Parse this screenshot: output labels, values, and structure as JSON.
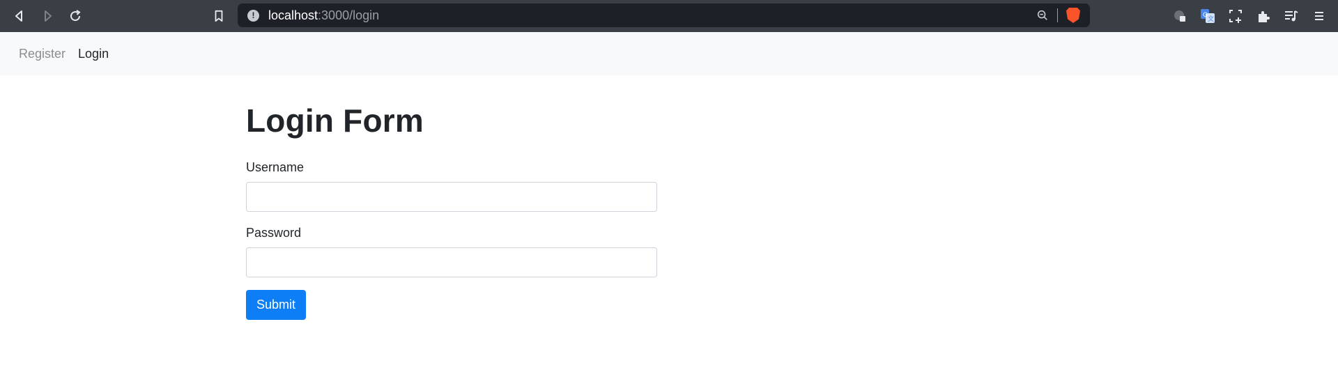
{
  "browser": {
    "url_host": "localhost",
    "url_path": ":3000/login"
  },
  "navbar": {
    "items": [
      {
        "label": "Register",
        "active": false
      },
      {
        "label": "Login",
        "active": true
      }
    ]
  },
  "form": {
    "title": "Login Form",
    "username_label": "Username",
    "username_value": "",
    "password_label": "Password",
    "password_value": "",
    "submit_label": "Submit"
  },
  "colors": {
    "chrome_bg": "#3a3e45",
    "navbar_bg": "#f8f9fa",
    "primary": "#0d7ef5"
  },
  "icons": [
    "back-icon",
    "forward-icon",
    "reload-icon",
    "bookmark-icon",
    "site-info-icon",
    "zoom-out-icon",
    "brave-shields-icon",
    "extension-a-icon",
    "translate-icon",
    "screenshot-icon",
    "extensions-icon",
    "media-icon",
    "menu-icon"
  ]
}
